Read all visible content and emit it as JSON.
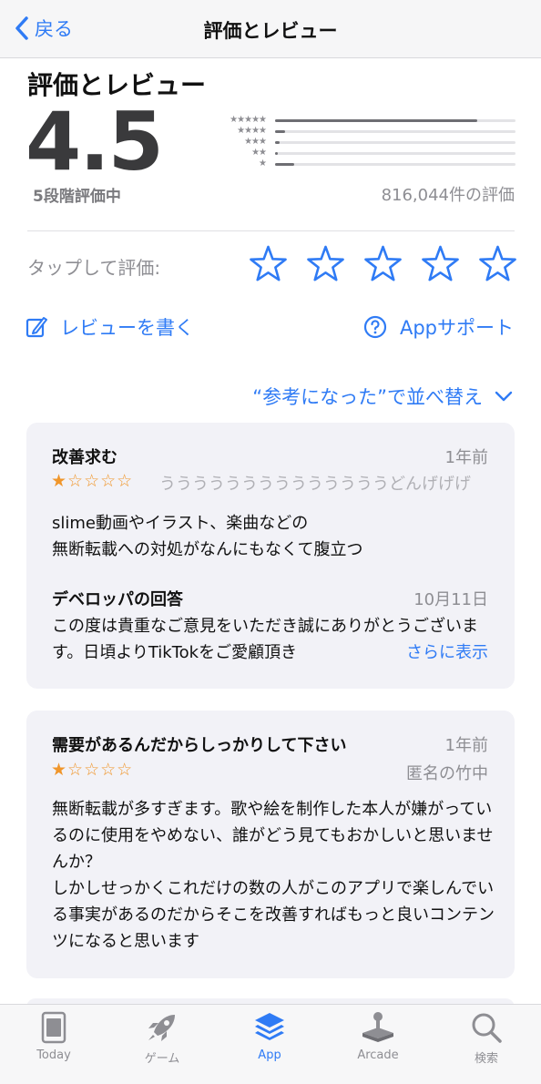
{
  "nav": {
    "back_label": "戻る",
    "title": "評価とレビュー"
  },
  "ratings": {
    "section_title": "評価とレビュー",
    "average": "4.5",
    "out_of": "5段階評価中",
    "total": "816,044件の評価",
    "histogram": [
      {
        "stars": "★★★★★",
        "fraction": 0.84
      },
      {
        "stars": "★★★★",
        "fraction": 0.04
      },
      {
        "stars": "★★★",
        "fraction": 0.02
      },
      {
        "stars": "★★",
        "fraction": 0.01
      },
      {
        "stars": "★",
        "fraction": 0.08
      }
    ]
  },
  "tap_to_rate": {
    "label": "タップして評価:",
    "star_count": 5,
    "star_color": "#2f7bf5"
  },
  "actions": {
    "write_review": "レビューを書く",
    "app_support": "Appサポート"
  },
  "sort": {
    "label": "“参考になった”で並べ替え"
  },
  "reviews": [
    {
      "title": "改善求む",
      "date": "1年前",
      "stars": "★☆☆☆☆",
      "author": "ううううううううううううううどんげげげ",
      "body": "slime動画やイラスト、楽曲などの\n無断転載への対処がなんにもなくて腹立つ",
      "developer_response": {
        "title": "デベロッパの回答",
        "date": "10月11日",
        "body": "この度は貴重なご意見をいただき誠にありがとうございます。日頃よりTikTokをご愛顧頂き",
        "more": "さらに表示"
      }
    },
    {
      "title": "需要があるんだからしっかりして下さい",
      "date": "1年前",
      "stars": "★☆☆☆☆",
      "author": "匿名の竹中",
      "body": "無断転載が多すぎます。歌や絵を制作した本人が嫌がっているのに使用をやめない、誰がどう見てもおかしいと思いませんか？\nしかしせっかくこれだけの数の人がこのアプリで楽しんでいる事実があるのだからそこを改善すればもっと良いコンテンツになると思います"
    }
  ],
  "tabbar": {
    "items": [
      {
        "label": "Today",
        "icon": "today-icon"
      },
      {
        "label": "ゲーム",
        "icon": "rocket-icon"
      },
      {
        "label": "App",
        "icon": "app-stack-icon",
        "active": true
      },
      {
        "label": "Arcade",
        "icon": "joystick-icon"
      },
      {
        "label": "検索",
        "icon": "search-icon"
      }
    ]
  },
  "colors": {
    "accent": "#2f7bf5",
    "star_orange": "#f0962b",
    "card_bg": "#f2f2f7"
  }
}
